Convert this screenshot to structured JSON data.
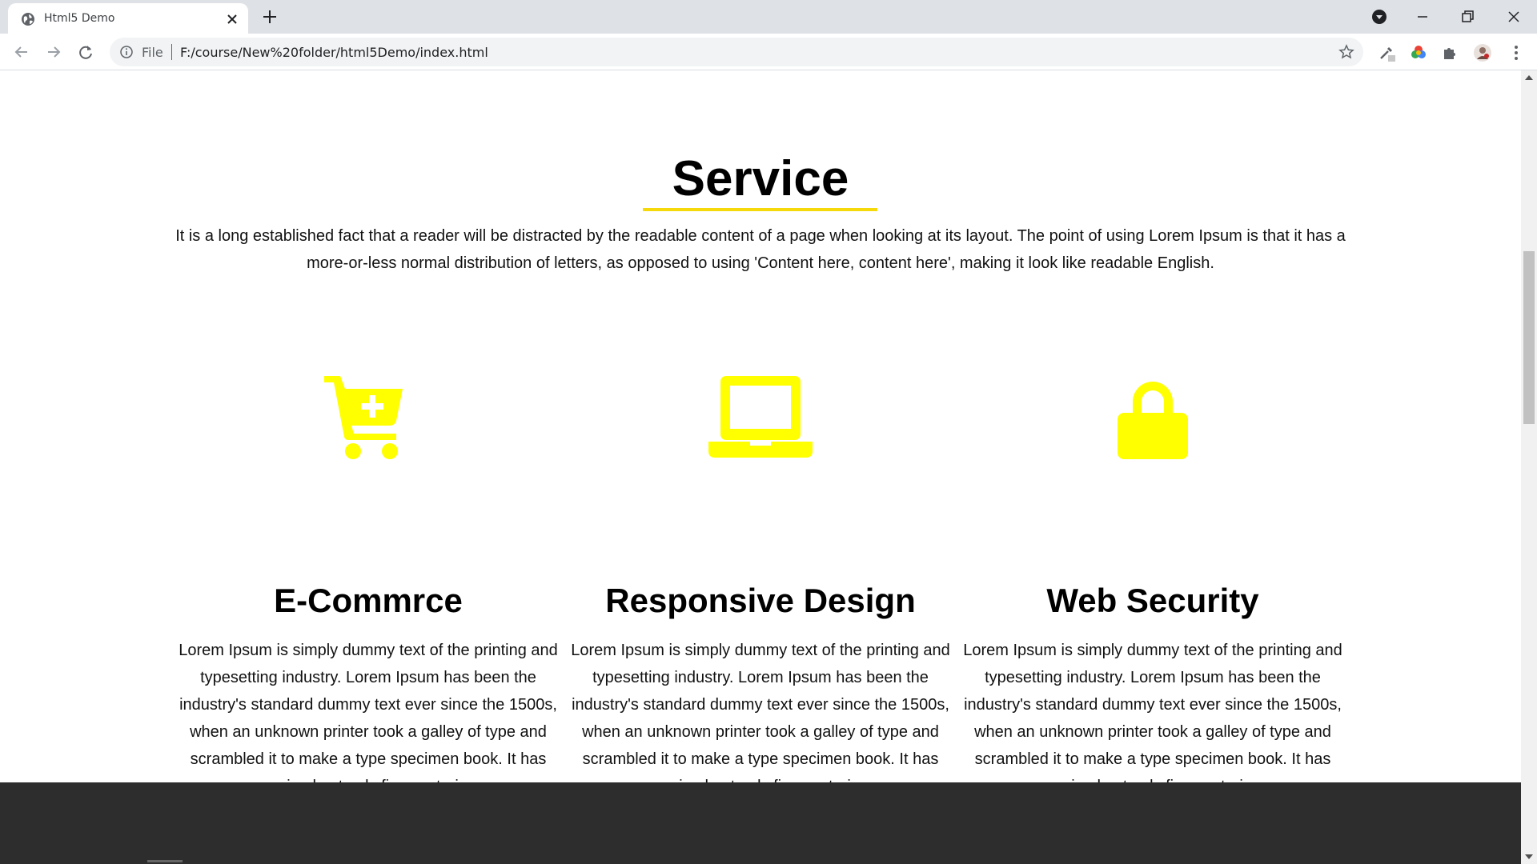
{
  "browser": {
    "tab_title": "Html5 Demo",
    "scheme_label": "File",
    "url": "F:/course/New%20folder/html5Demo/index.html"
  },
  "service": {
    "title": "Service",
    "intro": "It is a long established fact that a reader will be distracted by the readable content of a page when looking at its layout. The point of using Lorem Ipsum is that it has a more-or-less normal distribution of letters, as opposed to using 'Content here, content here', making it look like readable English.",
    "accent_color": "#ffff00",
    "items": [
      {
        "icon": "cart-plus-icon",
        "title": "E-Commrce",
        "text": "Lorem Ipsum is simply dummy text of the printing and typesetting industry. Lorem Ipsum has been the industry's standard dummy text ever since the 1500s, when an unknown printer took a galley of type and scrambled it to make a type specimen book. It has survived not only five centuries,"
      },
      {
        "icon": "laptop-icon",
        "title": "Responsive Design",
        "text": "Lorem Ipsum is simply dummy text of the printing and typesetting industry. Lorem Ipsum has been the industry's standard dummy text ever since the 1500s, when an unknown printer took a galley of type and scrambled it to make a type specimen book. It has survived not only five centuries,"
      },
      {
        "icon": "lock-icon",
        "title": "Web Security",
        "text": "Lorem Ipsum is simply dummy text of the printing and typesetting industry. Lorem Ipsum has been the industry's standard dummy text ever since the 1500s, when an unknown printer took a galley of type and scrambled it to make a type specimen book. It has survived not only five centuries,"
      }
    ]
  }
}
